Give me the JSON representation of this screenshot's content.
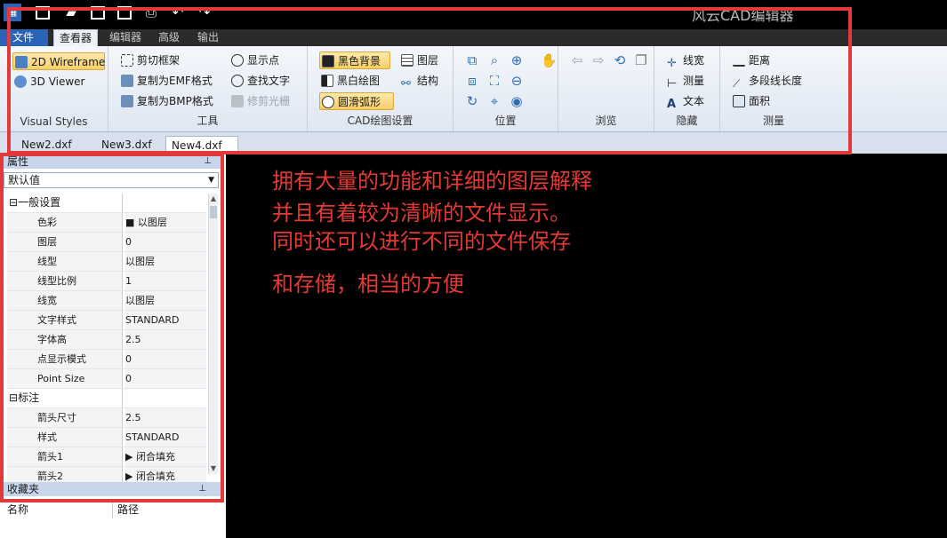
{
  "app": {
    "title": "风云CAD编辑器"
  },
  "menu": {
    "file": "文件",
    "tabs": [
      {
        "label": "查看器",
        "active": true
      },
      {
        "label": "编辑器"
      },
      {
        "label": "高级"
      },
      {
        "label": "输出"
      }
    ]
  },
  "ribbon": {
    "visual_styles": {
      "label": "Visual Styles",
      "wireframe": "2D Wireframe",
      "viewer": "3D Viewer"
    },
    "tools": {
      "label": "工具",
      "crop_frame": "剪切框架",
      "copy_emf": "复制为EMF格式",
      "copy_bmp": "复制为BMP格式",
      "show_points": "显示点",
      "find_text": "查找文字",
      "trim_raster": "修剪光栅"
    },
    "cad_settings": {
      "label": "CAD绘图设置",
      "black_bg": "黑色背景",
      "bw_drawing": "黑白绘图",
      "smooth_arcs": "圆滑弧形",
      "layers": "图层",
      "structure": "结构"
    },
    "position": {
      "label": "位置"
    },
    "browse": {
      "label": "浏览"
    },
    "hide": {
      "label": "隐藏",
      "line_width": "线宽",
      "measure": "测量",
      "text": "文本"
    },
    "measure": {
      "label": "测量",
      "distance": "距离",
      "polyline_length": "多段线长度",
      "area": "面积"
    }
  },
  "doc_tabs": [
    {
      "label": "New2.dxf"
    },
    {
      "label": "New3.dxf"
    },
    {
      "label": "New4.dxf",
      "active": true
    }
  ],
  "properties": {
    "header": "属性",
    "selector": "默认值",
    "general_label": "一般设置",
    "general": [
      {
        "key": "色彩",
        "value": "■ 以图层"
      },
      {
        "key": "图层",
        "value": "0"
      },
      {
        "key": "线型",
        "value": "以图层"
      },
      {
        "key": "线型比例",
        "value": "1"
      },
      {
        "key": "线宽",
        "value": "以图层"
      },
      {
        "key": "文字样式",
        "value": "STANDARD"
      },
      {
        "key": "字体高",
        "value": "2.5"
      },
      {
        "key": "点显示模式",
        "value": "0"
      },
      {
        "key": "Point Size",
        "value": "0"
      }
    ],
    "dim_label": "标注",
    "dimension": [
      {
        "key": "箭头尺寸",
        "value": "2.5"
      },
      {
        "key": "样式",
        "value": "STANDARD"
      },
      {
        "key": "箭头1",
        "value": "▶ 闭合填充"
      },
      {
        "key": "箭头2",
        "value": "▶ 闭合填充"
      }
    ]
  },
  "favorites": {
    "header": "收藏夹",
    "col_name": "名称",
    "col_path": "路径"
  },
  "annotation": {
    "line1": "拥有大量的功能和详细的图层解释",
    "line2": "并且有着较为清晰的文件显示。",
    "line3": "同时还可以进行不同的文件保存",
    "line4": "和存储，相当的方便"
  },
  "colors": {
    "annotation_red": "#e53935",
    "box_red": "#e23a3a",
    "file_tab": "#2b64b6",
    "canvas": "#000000"
  }
}
